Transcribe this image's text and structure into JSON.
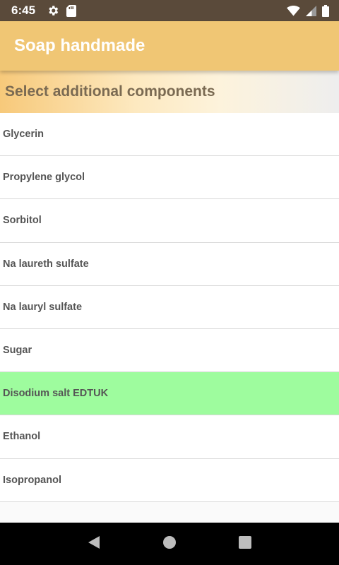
{
  "status_bar": {
    "time": "6:45",
    "icons": [
      "gear-icon",
      "sd-card-icon",
      "wifi-icon",
      "cell-signal-icon",
      "battery-icon"
    ]
  },
  "app_bar": {
    "title": "Soap handmade"
  },
  "section": {
    "title": "Select additional components"
  },
  "list": {
    "selected_index": 6,
    "items": [
      {
        "label": "Glycerin"
      },
      {
        "label": "Propylene glycol"
      },
      {
        "label": "Sorbitol"
      },
      {
        "label": "Na laureth sulfate"
      },
      {
        "label": "Na lauryl sulfate"
      },
      {
        "label": "Sugar"
      },
      {
        "label": "Disodium salt EDTUK"
      },
      {
        "label": "Ethanol"
      },
      {
        "label": "Isopropanol"
      }
    ]
  },
  "nav_bar": {
    "icons": [
      "back-icon",
      "home-icon",
      "recents-icon"
    ]
  },
  "colors": {
    "status_bar": "#5a4a3a",
    "app_bar": "#f0c674",
    "selected_row": "#9efc9e",
    "section_text": "#7a6a52"
  }
}
